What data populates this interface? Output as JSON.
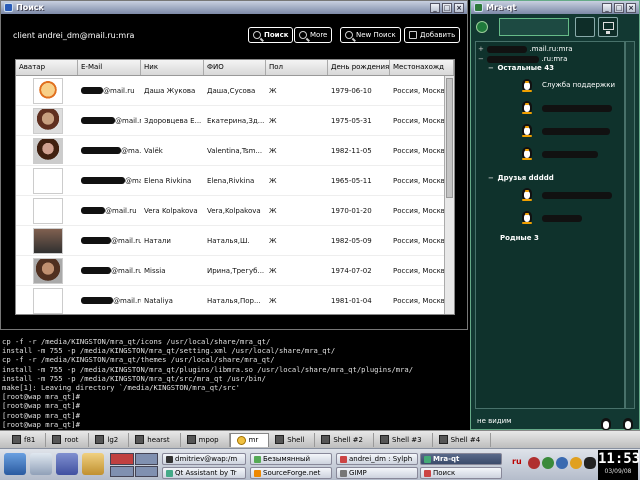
{
  "search_window": {
    "title": "Поиск",
    "client_label": "client andrei_dm@mail.ru:mra",
    "buttons": {
      "search": "Поиск",
      "more": "More",
      "new_search": "New Поиск",
      "add": "Добавить"
    },
    "columns": [
      "Аватар",
      "E-Mail",
      "Ник",
      "ФИО",
      "Пол",
      "День рождения",
      "Местонахожд"
    ],
    "rows": [
      {
        "email": "@mail.ru",
        "nick": "Даша Жукова",
        "fio": "Даша,Сусова",
        "sex": "Ж",
        "birthday": "1979-06-10",
        "location": "Россия, Москв"
      },
      {
        "email": "@mail.ru",
        "nick": "Здоровцева Е...",
        "fio": "Екатерина,Зд...",
        "sex": "Ж",
        "birthday": "1975-05-31",
        "location": "Россия, Москв"
      },
      {
        "email": "@ma...",
        "nick": "Valёk",
        "fio": "Valentina,Tsm...",
        "sex": "Ж",
        "birthday": "1982-11-05",
        "location": "Россия, Москв"
      },
      {
        "email": "@ma...",
        "nick": "Elena Rivkina",
        "fio": "Elena,Rivkina",
        "sex": "Ж",
        "birthday": "1965-05-11",
        "location": "Россия, Москв"
      },
      {
        "email": "@mail.ru",
        "nick": "Vera Kolpakova",
        "fio": "Vera,Kolpakova",
        "sex": "Ж",
        "birthday": "1970-01-20",
        "location": "Россия, Москв"
      },
      {
        "email": "@mail.ru",
        "nick": "Натали",
        "fio": "Наталья,Ш.",
        "sex": "Ж",
        "birthday": "1982-05-09",
        "location": "Россия, Москв"
      },
      {
        "email": "@mail.ru",
        "nick": "Missia",
        "fio": "Ирина,Трегуб...",
        "sex": "Ж",
        "birthday": "1974-07-02",
        "location": "Россия, Москв"
      },
      {
        "email": "@mail.ru",
        "nick": "Nataliya",
        "fio": "Наталья,Пор...",
        "sex": "Ж",
        "birthday": "1981-01-04",
        "location": "Россия, Москв"
      }
    ]
  },
  "terminal": {
    "lines": [
      "cp -f -r /media/KINGSTON/mra_qt/icons /usr/local/share/mra_qt/",
      "install -m 755 -p /media/KINGSTON/mra_qt/setting.xml /usr/local/share/mra_qt/",
      "cp -f -r /media/KINGSTON/mra_qt/themes /usr/local/share/mra_qt/",
      "install -m 755 -p /media/KINGSTON/mra_qt/plugins/libmra.so /usr/local/share/mra_qt/plugins/mra/",
      "install -m 755 -p /media/KINGSTON/mra_qt/src/mra_qt /usr/bin/",
      "make[1]: Leaving directory `/media/KINGSTON/mra_qt/src'",
      "[root@wap mra_qt]#",
      "[root@wap mra_qt]#",
      "[root@wap mra_qt]#",
      "[root@wap mra_qt]# "
    ]
  },
  "mra_window": {
    "title": "Mra-qt",
    "accounts": [
      ".mail.ru:mra",
      ".ru:mra"
    ],
    "groups": [
      {
        "label": "Остальные 43",
        "contacts": [
          "Служба поддержки"
        ]
      },
      {
        "label": "Друзья ddddd",
        "contacts": []
      },
      {
        "label": "Родные 3",
        "contacts": []
      }
    ],
    "status_text": "не видим"
  },
  "tabs_bar": {
    "tabs": [
      "f81",
      "root",
      "lg2",
      "hearst",
      "mpop",
      "mr",
      "Shell",
      "Shell #2",
      "Shell #3",
      "Shell #4"
    ],
    "active_index": 5
  },
  "panel": {
    "tasks": [
      {
        "label": "dmitriev@wap:/m",
        "active": false
      },
      {
        "label": "Безымянный",
        "active": false
      },
      {
        "label": "andrei_dm : Sylph",
        "active": false
      },
      {
        "label": "Mra-qt",
        "active": true
      },
      {
        "label": "Qt Assistant by Tr",
        "active": false
      },
      {
        "label": "SourceForge.net",
        "active": false
      },
      {
        "label": "GIMP",
        "active": false
      },
      {
        "label": "Поиск",
        "active": false
      }
    ],
    "keyboard_layout": "ru",
    "clock_time": "11:53",
    "clock_date": "03/09/08"
  }
}
